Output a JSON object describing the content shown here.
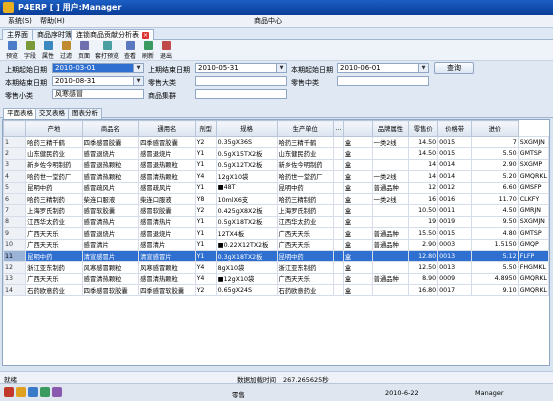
{
  "titlebar": {
    "title": "P4ERP [ ] 用户:Manager"
  },
  "menu": {
    "system": "系统(S)",
    "help": "帮助(H)",
    "product_center": "商品中心"
  },
  "tabs": [
    {
      "label": "主界面"
    },
    {
      "label": "商品序时簿"
    },
    {
      "label": "连锁商品贡献分析表"
    }
  ],
  "toolbar": [
    {
      "label": "预览",
      "color": "#4a7cc8"
    },
    {
      "label": "字段",
      "color": "#7a9a3a"
    },
    {
      "label": "属性",
      "color": "#3a8ac0"
    },
    {
      "label": "过滤",
      "color": "#c08a30"
    },
    {
      "label": "页面",
      "color": "#6f6fb0"
    },
    {
      "label": "套打预览",
      "color": "#4aa0a0"
    },
    {
      "label": "查看",
      "color": "#5a78c0"
    },
    {
      "label": "刷新",
      "color": "#3a9a60"
    },
    {
      "label": "退出",
      "color": "#c04a4a"
    }
  ],
  "filter": {
    "start_date_label": "上期起始日期",
    "start_date": "2010-03-01",
    "prev_end_label": "上期结束日期",
    "prev_end": "2010-05-31",
    "cur_start_label": "本期起始日期",
    "cur_start": "2010-06-01",
    "query_label": "查询",
    "cur_end_label": "本期结束日期",
    "cur_end": "2010-08-31",
    "big_cat_label": "零售大类",
    "big_cat": "",
    "mid_cat_label": "零售中类",
    "mid_cat": "",
    "small_cat_label": "零售小类",
    "small_cat": "风寒感冒",
    "product_set_label": "商品集群",
    "product_set": ""
  },
  "subtabs": [
    {
      "label": "平面表格"
    },
    {
      "label": "交叉表格"
    },
    {
      "label": "图表分析"
    }
  ],
  "grid": {
    "headers": [
      "产地",
      "商品名",
      "通用名",
      "剂型",
      "规格",
      "生产单位",
      "...",
      "品牌属性",
      "零售价",
      "价格带",
      "进价",
      "品名"
    ],
    "rows": [
      [
        "哈药三精千鹤",
        "四季感冒胶囊",
        "四季感冒胶囊",
        "Y2",
        "0.35gX36S",
        "哈药三精千鹤",
        "盒",
        "一类2线",
        "14.50",
        "0015",
        "7",
        "SXGMJN"
      ],
      [
        "山东健民药业",
        "感冒退烧片",
        "感冒退烧片",
        "Y1",
        "0.5gX15TX2板",
        "山东健民药业",
        "盒",
        "",
        "14.50",
        "0015",
        "5.50",
        "GMTSP"
      ],
      [
        "新乡佐今明制药",
        "感冒退热颗粒",
        "感冒退热颗粒",
        "Y1",
        "0.5gX12TX2板",
        "新乡佐今明制药",
        "盒",
        "",
        "14",
        "0014",
        "2.90",
        "SXGMP"
      ],
      [
        "哈药世一堂药厂",
        "感冒清热颗粒",
        "感冒清热颗粒",
        "Y4",
        "12gX10袋",
        "哈药世一堂药厂",
        "盒",
        "一类2线",
        "14",
        "0014",
        "5.20",
        "GMQRKL"
      ],
      [
        "昆明中药",
        "感冒疏风片",
        "感冒疏风片",
        "Y1",
        "■48T",
        "昆明中药",
        "盒",
        "普通品种",
        "12",
        "0012",
        "6.60",
        "GMSFP"
      ],
      [
        "哈药三精制药",
        "柴连口服液",
        "柴连口服液",
        "Y8",
        "10mlX6支",
        "哈药三精制药",
        "盒",
        "一类2线",
        "16",
        "0016",
        "11.70",
        "CLKFY"
      ],
      [
        "上海罗氏制药",
        "感冒软胶囊",
        "感冒软胶囊",
        "Y2",
        "0.425gX8X2板",
        "上海罗氏制药",
        "盒",
        "",
        "10.50",
        "0011",
        "4.50",
        "GMRJN"
      ],
      [
        "江西华太药业",
        "感冒清热片",
        "感冒清热片",
        "Y1",
        "0.5gX18TX2板",
        "江西华太药业",
        "盒",
        "",
        "19",
        "0019",
        "9.50",
        "SXGMJN"
      ],
      [
        "广西天天乐",
        "感冒退烧片",
        "感冒退烧片",
        "Y1",
        "12TX4板",
        "广西天天乐",
        "盒",
        "普通品种",
        "15.50",
        "0015",
        "4.80",
        "GMTSP"
      ],
      [
        "广西天天乐",
        "感冒清片",
        "感冒清片",
        "Y1",
        "■0.22X12TX2板",
        "广西天天乐",
        "盒",
        "普通品种",
        "2.90",
        "0003",
        "1.5150",
        "GMQP"
      ],
      [
        "昆明中药",
        "清宣感冒片",
        "清宣感冒片",
        "Y1",
        "0.3gX18TX2板",
        "昆明中药",
        "盒",
        "",
        "12.80",
        "0013",
        "5.12",
        "FLFP"
      ],
      [
        "浙江亚东制药",
        "风寒感冒颗粒",
        "风寒感冒颗粒",
        "Y4",
        "8gX10袋",
        "浙江亚东制药",
        "盒",
        "",
        "12.50",
        "0013",
        "5.50",
        "FHGMKL"
      ],
      [
        "广西天天乐",
        "感冒清热颗粒",
        "感冒清热颗粒",
        "Y4",
        "■12gX10袋",
        "广西天天乐",
        "盒",
        "普通品种",
        "8.90",
        "0009",
        "4.8950",
        "GMQRKL"
      ],
      [
        "石药欧意药业",
        "四季感冒软胶囊",
        "四季感冒软胶囊",
        "Y2",
        "0.65gX24S",
        "石药欧意药业",
        "盒",
        "",
        "16.80",
        "0017",
        "9.10",
        "GMQRKL"
      ]
    ],
    "selected_row": 10
  },
  "status": {
    "ready": "就绪",
    "load_time_label": "数据加载时间",
    "load_time": "267.265625秒",
    "retail": "零售",
    "date": "2010-6-22",
    "user": "Manager"
  }
}
